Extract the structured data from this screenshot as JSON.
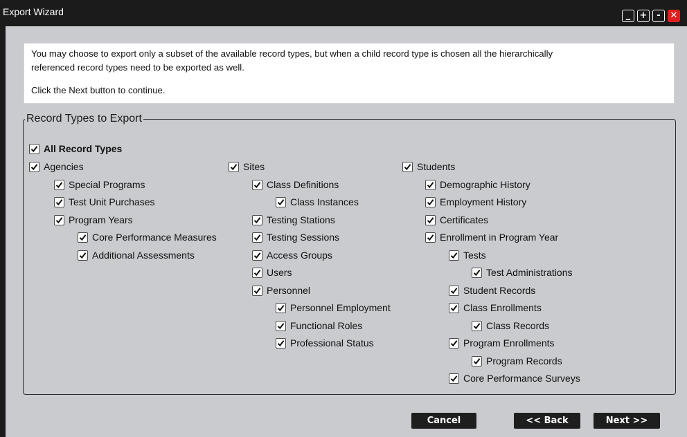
{
  "window": {
    "title": "Export Wizard"
  },
  "titlebar_buttons": {
    "minimize": "_",
    "maximize": "+",
    "restore": "-",
    "close": "✕"
  },
  "info": {
    "line1": "You may choose to export only a subset of the available record types, but when a child record type is chosen all the hierarchically",
    "line2": "referenced record types need to be exported as well.",
    "line3": "Click the Next button to continue."
  },
  "group": {
    "legend": "Record Types to Export"
  },
  "records": {
    "all": "All Record Types",
    "agencies": "Agencies",
    "special_programs": "Special Programs",
    "test_unit_purchases": "Test Unit Purchases",
    "program_years": "Program Years",
    "core_performance_measures": "Core Performance Measures",
    "additional_assessments": "Additional Assessments",
    "sites": "Sites",
    "class_definitions": "Class Definitions",
    "class_instances": "Class Instances",
    "testing_stations": "Testing Stations",
    "testing_sessions": "Testing Sessions",
    "access_groups": "Access Groups",
    "users": "Users",
    "personnel": "Personnel",
    "personnel_employment": "Personnel Employment",
    "functional_roles": "Functional Roles",
    "professional_status": "Professional Status",
    "students": "Students",
    "demographic_history": "Demographic History",
    "employment_history": "Employment History",
    "certificates": "Certificates",
    "enrollment_in_program_year": "Enrollment in Program Year",
    "tests": "Tests",
    "test_administrations": "Test Administrations",
    "student_records": "Student Records",
    "class_enrollments": "Class Enrollments",
    "class_records": "Class Records",
    "program_enrollments": "Program Enrollments",
    "program_records": "Program Records",
    "core_performance_surveys": "Core Performance Surveys"
  },
  "checked": true,
  "buttons": {
    "cancel": "Cancel",
    "back": "<< Back",
    "next": "Next >>"
  }
}
